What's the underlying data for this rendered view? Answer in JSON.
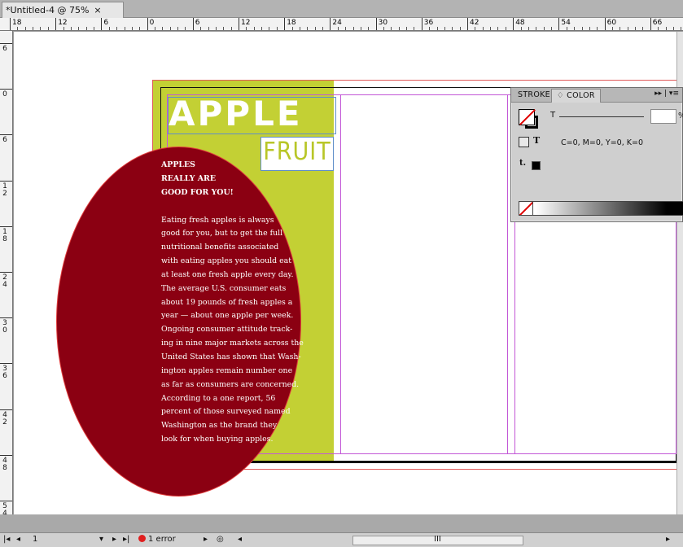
{
  "document_tab": {
    "title": "*Untitled-4 @ 75%",
    "close_glyph": "×"
  },
  "ruler_top": {
    "labels": [
      "18",
      "12",
      "6",
      "0",
      "6",
      "12",
      "18",
      "24",
      "30",
      "36",
      "42",
      "48",
      "54",
      "60",
      "66"
    ]
  },
  "ruler_left": {
    "labels": [
      "6",
      "0",
      "6",
      "1 2",
      "1 8",
      "2 4",
      "3 0",
      "3 6",
      "4 2",
      "4 8",
      "5 4"
    ]
  },
  "page": {
    "heading": "APPLE",
    "subheading": "FRUIT",
    "body_heading_lines": [
      "APPLES",
      "REALLY ARE",
      "GOOD FOR YOU!"
    ],
    "body_lines": [
      "Eating fresh apples is always",
      "good for you, but to get the full",
      "nutritional benefits associated",
      "with eating apples you should eat",
      "at least one fresh apple every day.",
      "The average U.S. consumer eats",
      "about 19 pounds of fresh apples a",
      "year — about one apple per week.",
      "Ongoing consumer attitude track-",
      "ing in nine major markets across the",
      "United States has shown that Wash-",
      "ington apples remain number one",
      "as far as consumers are concerned.",
      "According to a one report, 56",
      "percent of those surveyed named",
      "Washington as the brand they",
      "look for when buying apples."
    ],
    "colors": {
      "green": "#c3d034",
      "red": "#8b0012",
      "fruit_text": "#b8c628"
    }
  },
  "color_panel": {
    "tabs": [
      "STROKE",
      "♢ COLOR"
    ],
    "menu_glyph": "▸▸ | ▾≡",
    "tint_label": "T",
    "tint_value": "",
    "percent_sign": "%",
    "text_icon_label": "T",
    "color_values": "C=0, M=0, Y=0, K=0",
    "small_t_label": "t."
  },
  "status_bar": {
    "page_number": "1",
    "nav_first": "|◂",
    "nav_prev": "◂",
    "nav_next": "▸",
    "nav_last": "▸|",
    "error_text": "1 error",
    "dropdown_glyph": "▾",
    "scroll_grip": "III"
  }
}
